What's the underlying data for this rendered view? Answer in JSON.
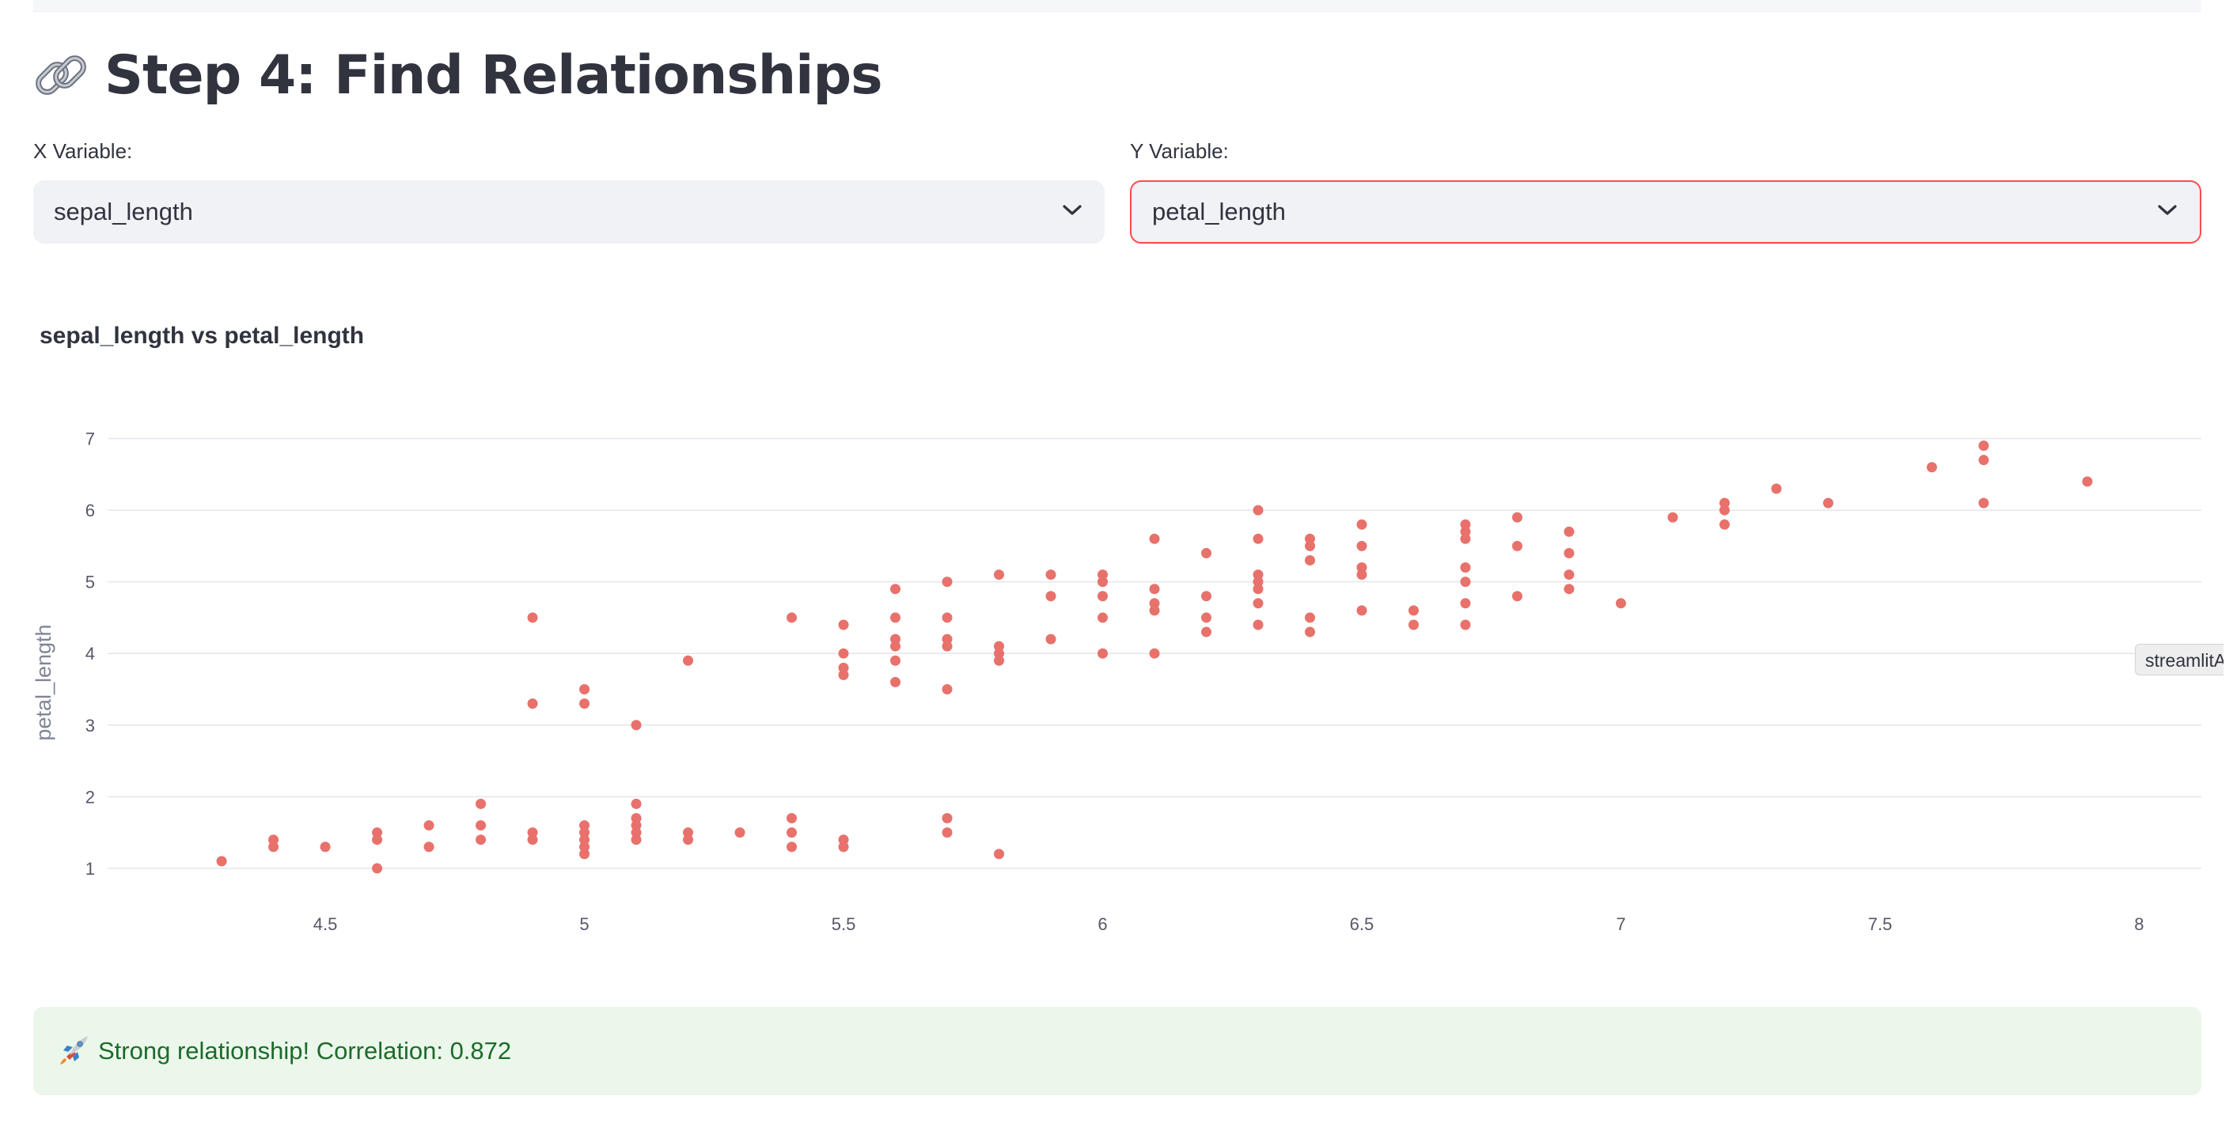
{
  "header": {
    "title": "Step 4: Find Relationships",
    "icon": "link-icon"
  },
  "x_select": {
    "label": "X Variable:",
    "value": "sepal_length"
  },
  "y_select": {
    "label": "Y Variable:",
    "value": "petal_length",
    "focused": true
  },
  "chart_title": "sepal_length vs petal_length",
  "tooltip": "streamlitAp",
  "success": {
    "icon": "rocket-icon",
    "text": "Strong relationship! Correlation: 0.872"
  },
  "colors": {
    "accent": "#ff4b4b",
    "marker": "#e8716b",
    "success_bg": "#ecf7ec",
    "success_text": "#1b6b2a",
    "select_bg": "#f0f2f6"
  },
  "chart_data": {
    "type": "scatter",
    "title": "sepal_length vs petal_length",
    "xlabel": "sepal_length",
    "ylabel": "petal_length",
    "xlim": [
      4.08,
      8.12
    ],
    "ylim": [
      0.69,
      7.16
    ],
    "xticks": [
      "4.5",
      "5",
      "5.5",
      "6",
      "6.5",
      "7",
      "7.5",
      "8"
    ],
    "yticks": [
      "1",
      "2",
      "3",
      "4",
      "5",
      "6",
      "7"
    ],
    "grid": true,
    "points": [
      [
        4.3,
        1.1
      ],
      [
        4.4,
        1.3
      ],
      [
        4.4,
        1.4
      ],
      [
        4.5,
        1.3
      ],
      [
        4.6,
        1.0
      ],
      [
        4.6,
        1.4
      ],
      [
        4.6,
        1.5
      ],
      [
        4.7,
        1.3
      ],
      [
        4.7,
        1.6
      ],
      [
        4.8,
        1.4
      ],
      [
        4.8,
        1.6
      ],
      [
        4.8,
        1.9
      ],
      [
        4.9,
        1.4
      ],
      [
        4.9,
        1.5
      ],
      [
        4.9,
        3.3
      ],
      [
        4.9,
        4.5
      ],
      [
        5.0,
        1.2
      ],
      [
        5.0,
        1.3
      ],
      [
        5.0,
        1.4
      ],
      [
        5.0,
        1.5
      ],
      [
        5.0,
        1.6
      ],
      [
        5.0,
        3.3
      ],
      [
        5.0,
        3.5
      ],
      [
        5.1,
        1.4
      ],
      [
        5.1,
        1.5
      ],
      [
        5.1,
        1.6
      ],
      [
        5.1,
        1.7
      ],
      [
        5.1,
        1.9
      ],
      [
        5.1,
        3.0
      ],
      [
        5.2,
        1.4
      ],
      [
        5.2,
        1.5
      ],
      [
        5.2,
        3.9
      ],
      [
        5.3,
        1.5
      ],
      [
        5.4,
        1.3
      ],
      [
        5.4,
        1.5
      ],
      [
        5.4,
        1.7
      ],
      [
        5.4,
        4.5
      ],
      [
        5.5,
        1.3
      ],
      [
        5.5,
        1.4
      ],
      [
        5.5,
        3.7
      ],
      [
        5.5,
        3.8
      ],
      [
        5.5,
        4.0
      ],
      [
        5.5,
        4.4
      ],
      [
        5.6,
        3.6
      ],
      [
        5.6,
        3.9
      ],
      [
        5.6,
        4.1
      ],
      [
        5.6,
        4.2
      ],
      [
        5.6,
        4.5
      ],
      [
        5.6,
        4.9
      ],
      [
        5.7,
        1.5
      ],
      [
        5.7,
        1.7
      ],
      [
        5.7,
        3.5
      ],
      [
        5.7,
        4.1
      ],
      [
        5.7,
        4.2
      ],
      [
        5.7,
        4.5
      ],
      [
        5.7,
        5.0
      ],
      [
        5.8,
        1.2
      ],
      [
        5.8,
        3.9
      ],
      [
        5.8,
        4.0
      ],
      [
        5.8,
        4.1
      ],
      [
        5.8,
        5.1
      ],
      [
        5.9,
        4.2
      ],
      [
        5.9,
        4.8
      ],
      [
        5.9,
        5.1
      ],
      [
        6.0,
        4.0
      ],
      [
        6.0,
        4.5
      ],
      [
        6.0,
        4.8
      ],
      [
        6.0,
        5.0
      ],
      [
        6.0,
        5.1
      ],
      [
        6.1,
        4.0
      ],
      [
        6.1,
        4.6
      ],
      [
        6.1,
        4.7
      ],
      [
        6.1,
        4.9
      ],
      [
        6.1,
        5.6
      ],
      [
        6.2,
        4.3
      ],
      [
        6.2,
        4.5
      ],
      [
        6.2,
        4.8
      ],
      [
        6.2,
        5.4
      ],
      [
        6.3,
        4.4
      ],
      [
        6.3,
        4.7
      ],
      [
        6.3,
        4.9
      ],
      [
        6.3,
        5.0
      ],
      [
        6.3,
        5.1
      ],
      [
        6.3,
        5.6
      ],
      [
        6.3,
        6.0
      ],
      [
        6.4,
        4.3
      ],
      [
        6.4,
        4.5
      ],
      [
        6.4,
        5.3
      ],
      [
        6.4,
        5.5
      ],
      [
        6.4,
        5.6
      ],
      [
        6.5,
        4.6
      ],
      [
        6.5,
        5.1
      ],
      [
        6.5,
        5.2
      ],
      [
        6.5,
        5.5
      ],
      [
        6.5,
        5.8
      ],
      [
        6.6,
        4.4
      ],
      [
        6.6,
        4.6
      ],
      [
        6.7,
        4.4
      ],
      [
        6.7,
        4.7
      ],
      [
        6.7,
        5.0
      ],
      [
        6.7,
        5.2
      ],
      [
        6.7,
        5.6
      ],
      [
        6.7,
        5.7
      ],
      [
        6.7,
        5.8
      ],
      [
        6.8,
        4.8
      ],
      [
        6.8,
        5.5
      ],
      [
        6.8,
        5.9
      ],
      [
        6.9,
        4.9
      ],
      [
        6.9,
        5.1
      ],
      [
        6.9,
        5.4
      ],
      [
        6.9,
        5.7
      ],
      [
        7.0,
        4.7
      ],
      [
        7.1,
        5.9
      ],
      [
        7.2,
        5.8
      ],
      [
        7.2,
        6.0
      ],
      [
        7.2,
        6.1
      ],
      [
        7.3,
        6.3
      ],
      [
        7.4,
        6.1
      ],
      [
        7.6,
        6.6
      ],
      [
        7.7,
        6.1
      ],
      [
        7.7,
        6.7
      ],
      [
        7.7,
        6.9
      ],
      [
        7.9,
        6.4
      ]
    ]
  }
}
